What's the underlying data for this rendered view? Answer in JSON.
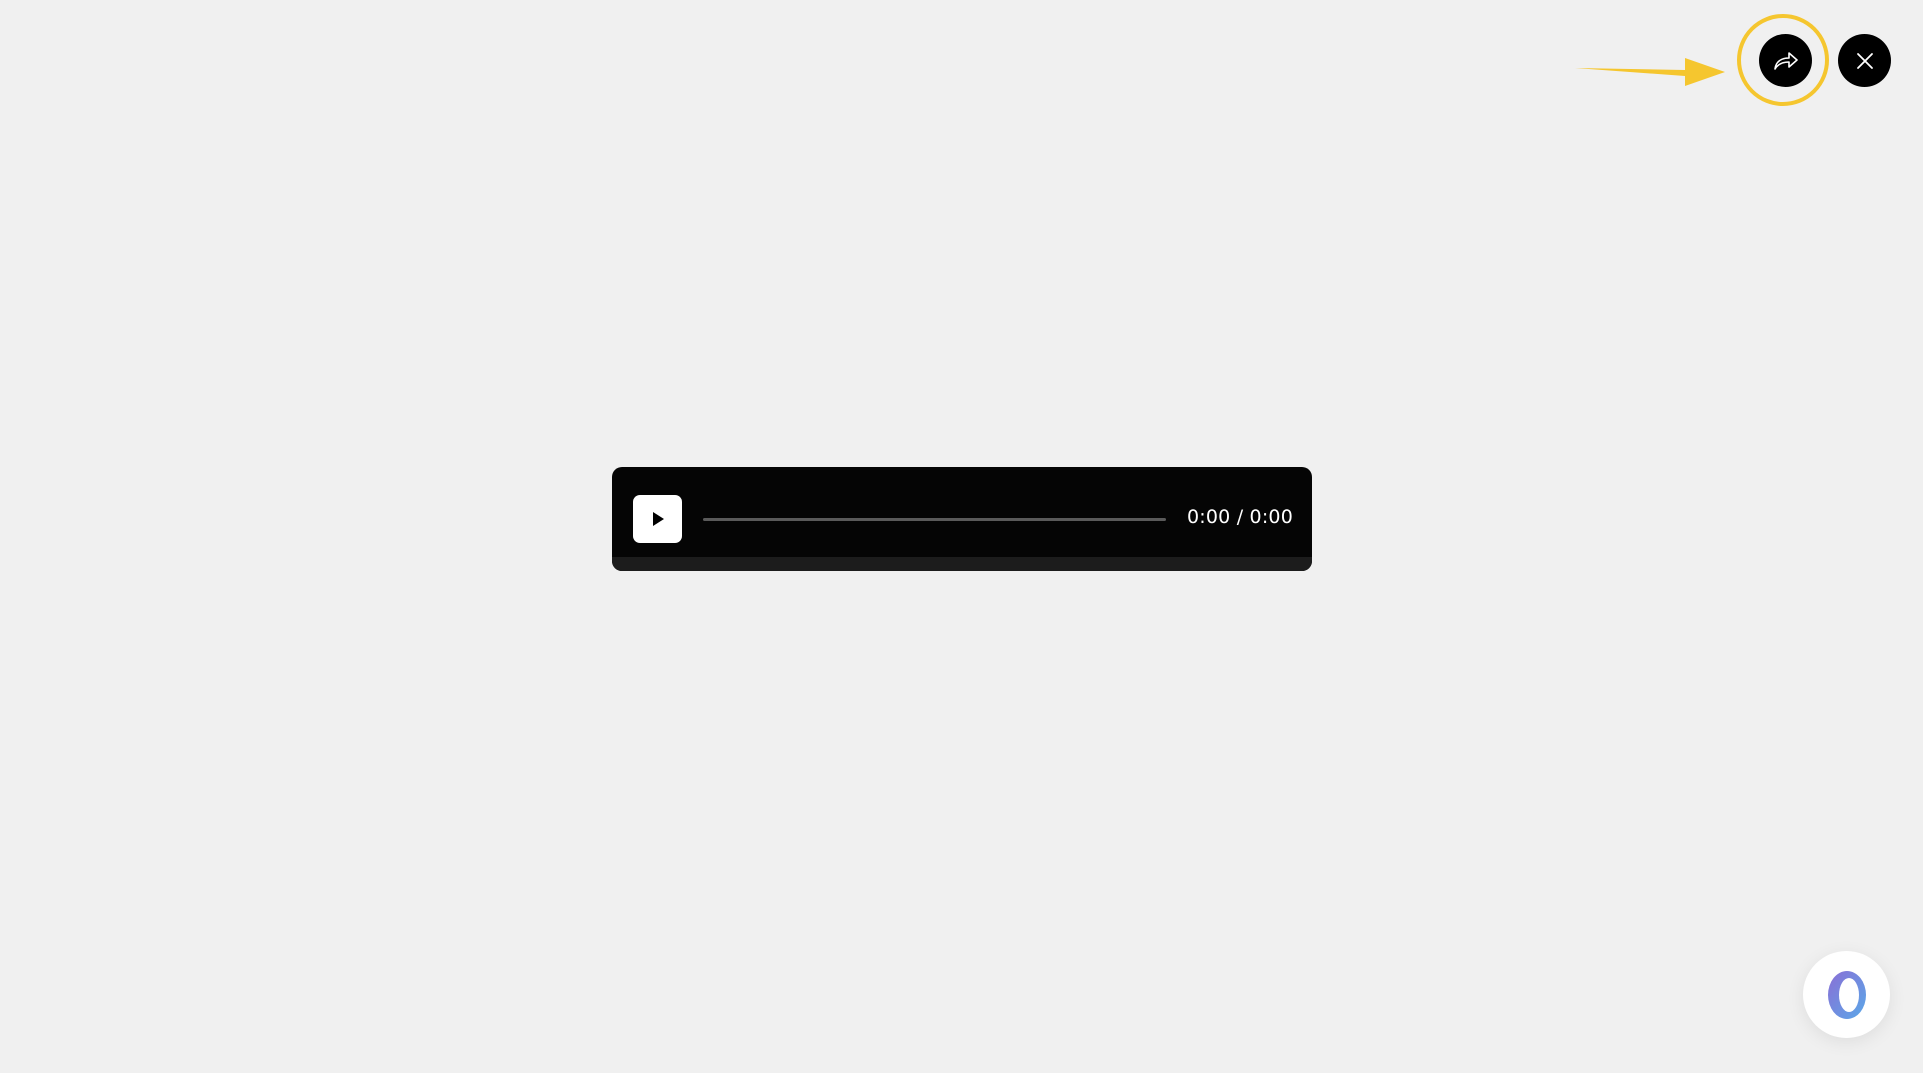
{
  "player": {
    "time_display": "0:00 / 0:00",
    "progress_fraction": 0
  },
  "controls": {
    "share_icon": "share-arrow-icon",
    "close_icon": "close-icon",
    "play_icon": "play-icon",
    "assistant_icon": "assistant-logo-icon"
  },
  "colors": {
    "background": "#f0f0f0",
    "player_bg": "#050505",
    "highlight": "#f5c62f",
    "button_bg": "#000000"
  }
}
